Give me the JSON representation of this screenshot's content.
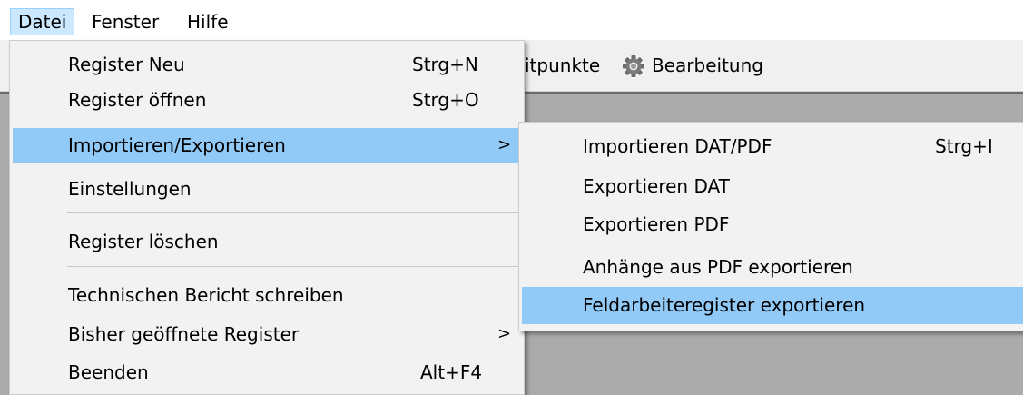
{
  "menubar": {
    "items": [
      {
        "label": "Datei"
      },
      {
        "label": "Fenster"
      },
      {
        "label": "Hilfe"
      }
    ]
  },
  "toolbar": {
    "partial_label": "itpunkte",
    "bearbeitung_label": "Bearbeitung",
    "bearbeitung_icon": "gear-icon"
  },
  "file_menu": {
    "items": [
      {
        "label": "Register Neu",
        "shortcut": "Strg+N"
      },
      {
        "label": "Register öffnen",
        "shortcut": "Strg+O"
      },
      {
        "label": "Importieren/Exportieren",
        "arrow": ">"
      },
      {
        "label": "Einstellungen"
      },
      {
        "label": "Register löschen"
      },
      {
        "label": "Technischen Bericht schreiben"
      },
      {
        "label": "Bisher geöffnete Register",
        "arrow": ">"
      },
      {
        "label": "Beenden",
        "shortcut": "Alt+F4"
      }
    ]
  },
  "submenu": {
    "items": [
      {
        "label": "Importieren DAT/PDF",
        "shortcut": "Strg+I"
      },
      {
        "label": "Exportieren DAT"
      },
      {
        "label": "Exportieren PDF"
      },
      {
        "label": "Anhänge aus PDF exportieren"
      },
      {
        "label": "Feldarbeiteregister exportieren"
      }
    ]
  },
  "colors": {
    "highlight": "#91c9f7",
    "menubar_active": "#cce8ff",
    "workspace": "#ababab"
  }
}
